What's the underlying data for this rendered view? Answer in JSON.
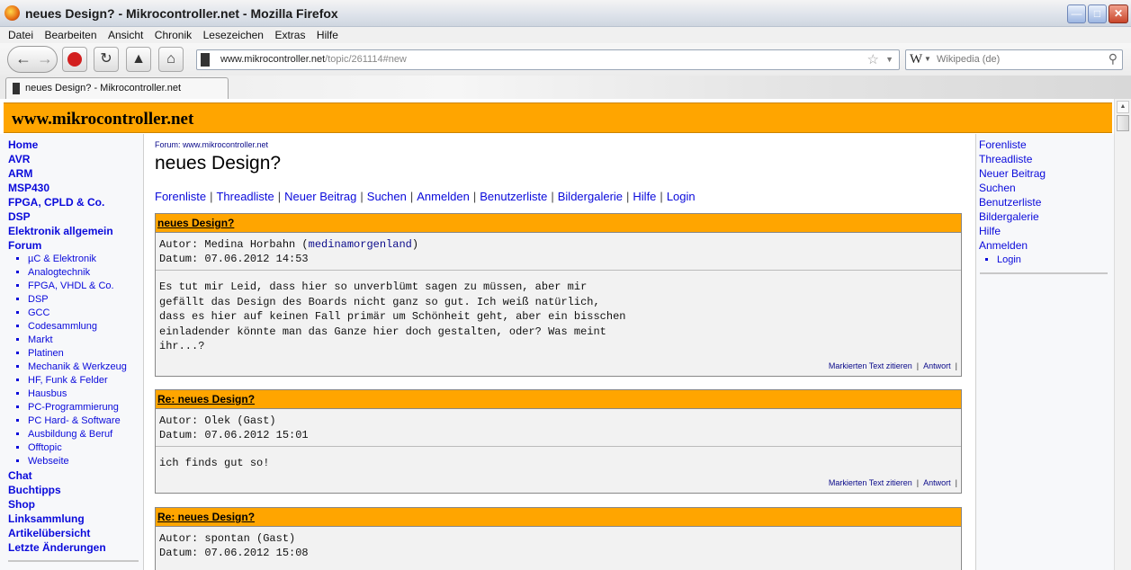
{
  "window": {
    "title": "neues Design? - Mikrocontroller.net - Mozilla Firefox",
    "minimize_icon": "minimize-icon",
    "maximize_icon": "maximize-icon",
    "close_icon": "close-icon"
  },
  "menubar": [
    "Datei",
    "Bearbeiten",
    "Ansicht",
    "Chronik",
    "Lesezeichen",
    "Extras",
    "Hilfe"
  ],
  "toolbar": {
    "url_domain": "www.mikrocontroller.net",
    "url_path": "/topic/261114#new",
    "search_engine_icon": "W",
    "search_placeholder": "Wikipedia (de)"
  },
  "tab": {
    "label": "neues Design? - Mikrocontroller.net"
  },
  "site": {
    "logo": "www.mikrocontroller.net"
  },
  "leftnav": {
    "main": [
      "Home",
      "AVR",
      "ARM",
      "MSP430",
      "FPGA, CPLD & Co.",
      "DSP",
      "Elektronik allgemein",
      "Forum"
    ],
    "forums": [
      "µC & Elektronik",
      "Analogtechnik",
      "FPGA, VHDL & Co.",
      "DSP",
      "GCC",
      "Codesammlung",
      "Markt",
      "Platinen",
      "Mechanik & Werkzeug",
      "HF, Funk & Felder",
      "Hausbus",
      "PC-Programmierung",
      "PC Hard- & Software",
      "Ausbildung & Beruf",
      "Offtopic",
      "Webseite"
    ],
    "bottom": [
      "Chat",
      "Buchtipps",
      "Shop",
      "Linksammlung",
      "Artikelübersicht",
      "Letzte Änderungen"
    ]
  },
  "main": {
    "breadcrumb": "Forum: www.mikrocontroller.net",
    "title": "neues Design?",
    "navlinks": [
      "Forenliste",
      "Threadliste",
      "Neuer Beitrag",
      "Suchen",
      "Anmelden",
      "Benutzerliste",
      "Bildergalerie",
      "Hilfe",
      "Login"
    ],
    "posts": [
      {
        "subject": "neues Design?",
        "author_label": "Autor: Medina Horbahn (",
        "username": "medinamorgenland",
        "author_close": ")",
        "date": "Datum: 07.06.2012 14:53",
        "body": "Es tut mir Leid, dass hier so unverblümt sagen zu müssen, aber mir\ngefällt das Design des Boards nicht ganz so gut. Ich weiß natürlich,\ndass es hier auf keinen Fall primär um Schönheit geht, aber ein bisschen\neinladender könnte man das Ganze hier doch gestalten, oder? Was meint\nihr...?",
        "quote": "Markierten Text zitieren",
        "reply": "Antwort"
      },
      {
        "subject": "Re: neues Design?",
        "author": "Autor: Olek (Gast)",
        "date": "Datum: 07.06.2012 15:01",
        "body": "ich finds gut so!",
        "quote": "Markierten Text zitieren",
        "reply": "Antwort"
      },
      {
        "subject": "Re: neues Design?",
        "author": "Autor: spontan (Gast)",
        "date": "Datum: 07.06.2012 15:08"
      }
    ]
  },
  "rightnav": {
    "links": [
      "Forenliste",
      "Threadliste",
      "Neuer Beitrag",
      "Suchen",
      "Benutzerliste",
      "Bildergalerie",
      "Hilfe",
      "Anmelden"
    ],
    "sub": [
      "Login"
    ]
  }
}
